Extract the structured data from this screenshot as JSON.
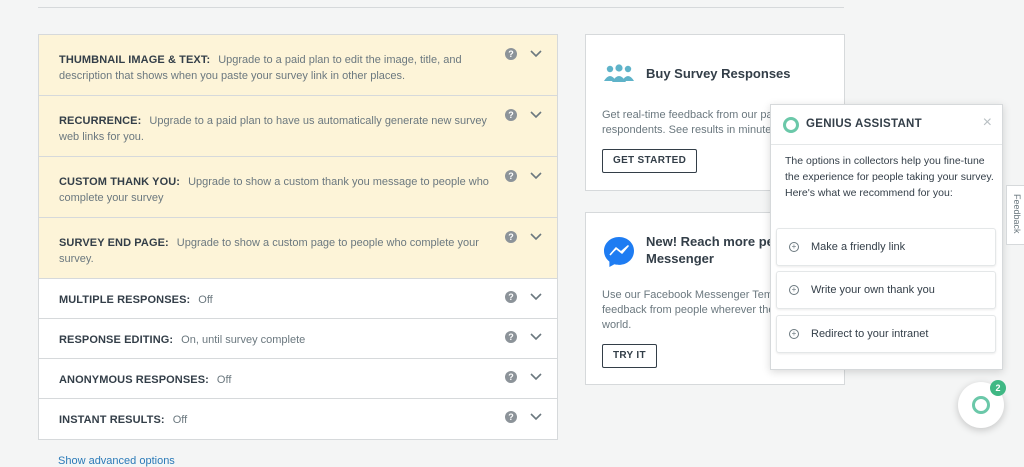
{
  "settings": {
    "rows": [
      {
        "label": "THUMBNAIL IMAGE & TEXT:",
        "text": "Upgrade to a paid plan to edit the image, title, and description that shows when you paste your survey link in other places."
      },
      {
        "label": "RECURRENCE:",
        "text": "Upgrade to a paid plan to have us automatically generate new survey web links for you."
      },
      {
        "label": "CUSTOM THANK YOU:",
        "text": "Upgrade to show a custom thank you message to people who complete your survey"
      },
      {
        "label": "SURVEY END PAGE:",
        "text": "Upgrade to show a custom page to people who complete your survey."
      },
      {
        "label": "MULTIPLE RESPONSES:",
        "text": "Off"
      },
      {
        "label": "RESPONSE EDITING:",
        "text": "On, until survey complete"
      },
      {
        "label": "ANONYMOUS RESPONSES:",
        "text": "Off"
      },
      {
        "label": "INSTANT RESULTS:",
        "text": "Off"
      }
    ],
    "help_glyph": "?",
    "advanced_link": "Show advanced options"
  },
  "cards": {
    "buy": {
      "title": "Buy Survey Responses",
      "body_line1": "Get real-time feedback from our pa",
      "body_line2": "respondents. See results in minutes",
      "button": "GET STARTED"
    },
    "messenger": {
      "title_line1": "New! Reach more peo",
      "title_line2": "Messenger",
      "body_line1": "Use our Facebook Messenger Templ",
      "body_line2": "feedback from people wherever the",
      "body_line3": "world.",
      "button": "TRY IT"
    }
  },
  "genius": {
    "title": "GENIUS ASSISTANT",
    "close": "×",
    "message": "The options in collectors help you fine-tune the experience for people taking your survey. Here's what we recommend for you:",
    "items": [
      {
        "label": "Make a friendly link"
      },
      {
        "label": "Write your own thank you"
      },
      {
        "label": "Redirect to your intranet"
      }
    ]
  },
  "feedback_tab": "Feedback",
  "fab": {
    "badge": "2"
  },
  "colors": {
    "accent": "#6bc8a9",
    "paid_bg": "#fdf4d8",
    "link": "#2a7ab8",
    "messenger_blue": "#1e7cf2",
    "people_icon": "#5fb3c9"
  }
}
